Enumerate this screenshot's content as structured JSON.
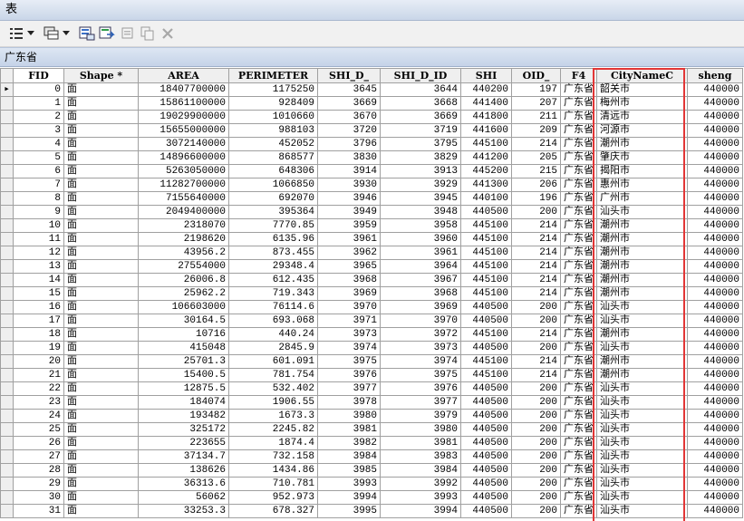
{
  "window": {
    "title": "表"
  },
  "tab": {
    "label": "广东省"
  },
  "toolbar": {
    "icons": [
      "table-options-icon",
      "dropdown-arrow-icon",
      "related-tables-icon",
      "dropdown-arrow-icon",
      "select-by-attributes-icon",
      "switch-selection-icon",
      "clear-selection-icon",
      "copy-selected-icon",
      "delete-selected-icon"
    ]
  },
  "grid": {
    "columns": [
      "FID",
      "Shape *",
      "AREA",
      "PERIMETER",
      "SHI_D_",
      "SHI_D_ID",
      "SHI",
      "OID_",
      "F4",
      "CityNameC",
      "sheng"
    ],
    "current_row_marker": "▸",
    "rows": [
      [
        "0",
        "面",
        "18407700000",
        "1175250",
        "3645",
        "3644",
        "440200",
        "197",
        "广东省",
        "韶关市",
        "440000"
      ],
      [
        "1",
        "面",
        "15861100000",
        "928409",
        "3669",
        "3668",
        "441400",
        "207",
        "广东省",
        "梅州市",
        "440000"
      ],
      [
        "2",
        "面",
        "19029900000",
        "1010660",
        "3670",
        "3669",
        "441800",
        "211",
        "广东省",
        "清远市",
        "440000"
      ],
      [
        "3",
        "面",
        "15655000000",
        "988103",
        "3720",
        "3719",
        "441600",
        "209",
        "广东省",
        "河源市",
        "440000"
      ],
      [
        "4",
        "面",
        "3072140000",
        "452052",
        "3796",
        "3795",
        "445100",
        "214",
        "广东省",
        "潮州市",
        "440000"
      ],
      [
        "5",
        "面",
        "14896600000",
        "868577",
        "3830",
        "3829",
        "441200",
        "205",
        "广东省",
        "肇庆市",
        "440000"
      ],
      [
        "6",
        "面",
        "5263050000",
        "648306",
        "3914",
        "3913",
        "445200",
        "215",
        "广东省",
        "揭阳市",
        "440000"
      ],
      [
        "7",
        "面",
        "11282700000",
        "1066850",
        "3930",
        "3929",
        "441300",
        "206",
        "广东省",
        "惠州市",
        "440000"
      ],
      [
        "8",
        "面",
        "7155640000",
        "692070",
        "3946",
        "3945",
        "440100",
        "196",
        "广东省",
        "广州市",
        "440000"
      ],
      [
        "9",
        "面",
        "2049400000",
        "395364",
        "3949",
        "3948",
        "440500",
        "200",
        "广东省",
        "汕头市",
        "440000"
      ],
      [
        "10",
        "面",
        "2318070",
        "7770.85",
        "3959",
        "3958",
        "445100",
        "214",
        "广东省",
        "潮州市",
        "440000"
      ],
      [
        "11",
        "面",
        "2198620",
        "6135.96",
        "3961",
        "3960",
        "445100",
        "214",
        "广东省",
        "潮州市",
        "440000"
      ],
      [
        "12",
        "面",
        "43956.2",
        "873.455",
        "3962",
        "3961",
        "445100",
        "214",
        "广东省",
        "潮州市",
        "440000"
      ],
      [
        "13",
        "面",
        "27554000",
        "29348.4",
        "3965",
        "3964",
        "445100",
        "214",
        "广东省",
        "潮州市",
        "440000"
      ],
      [
        "14",
        "面",
        "26006.8",
        "612.435",
        "3968",
        "3967",
        "445100",
        "214",
        "广东省",
        "潮州市",
        "440000"
      ],
      [
        "15",
        "面",
        "25962.2",
        "719.343",
        "3969",
        "3968",
        "445100",
        "214",
        "广东省",
        "潮州市",
        "440000"
      ],
      [
        "16",
        "面",
        "106603000",
        "76114.6",
        "3970",
        "3969",
        "440500",
        "200",
        "广东省",
        "汕头市",
        "440000"
      ],
      [
        "17",
        "面",
        "30164.5",
        "693.068",
        "3971",
        "3970",
        "440500",
        "200",
        "广东省",
        "汕头市",
        "440000"
      ],
      [
        "18",
        "面",
        "10716",
        "440.24",
        "3973",
        "3972",
        "445100",
        "214",
        "广东省",
        "潮州市",
        "440000"
      ],
      [
        "19",
        "面",
        "415048",
        "2845.9",
        "3974",
        "3973",
        "440500",
        "200",
        "广东省",
        "汕头市",
        "440000"
      ],
      [
        "20",
        "面",
        "25701.3",
        "601.091",
        "3975",
        "3974",
        "445100",
        "214",
        "广东省",
        "潮州市",
        "440000"
      ],
      [
        "21",
        "面",
        "15400.5",
        "781.754",
        "3976",
        "3975",
        "445100",
        "214",
        "广东省",
        "潮州市",
        "440000"
      ],
      [
        "22",
        "面",
        "12875.5",
        "532.402",
        "3977",
        "3976",
        "440500",
        "200",
        "广东省",
        "汕头市",
        "440000"
      ],
      [
        "23",
        "面",
        "184074",
        "1906.55",
        "3978",
        "3977",
        "440500",
        "200",
        "广东省",
        "汕头市",
        "440000"
      ],
      [
        "24",
        "面",
        "193482",
        "1673.3",
        "3980",
        "3979",
        "440500",
        "200",
        "广东省",
        "汕头市",
        "440000"
      ],
      [
        "25",
        "面",
        "325172",
        "2245.82",
        "3981",
        "3980",
        "440500",
        "200",
        "广东省",
        "汕头市",
        "440000"
      ],
      [
        "26",
        "面",
        "223655",
        "1874.4",
        "3982",
        "3981",
        "440500",
        "200",
        "广东省",
        "汕头市",
        "440000"
      ],
      [
        "27",
        "面",
        "37134.7",
        "732.158",
        "3984",
        "3983",
        "440500",
        "200",
        "广东省",
        "汕头市",
        "440000"
      ],
      [
        "28",
        "面",
        "138626",
        "1434.86",
        "3985",
        "3984",
        "440500",
        "200",
        "广东省",
        "汕头市",
        "440000"
      ],
      [
        "29",
        "面",
        "36313.6",
        "710.781",
        "3993",
        "3992",
        "440500",
        "200",
        "广东省",
        "汕头市",
        "440000"
      ],
      [
        "30",
        "面",
        "56062",
        "952.973",
        "3994",
        "3993",
        "440500",
        "200",
        "广东省",
        "汕头市",
        "440000"
      ],
      [
        "31",
        "面",
        "33253.3",
        "678.327",
        "3995",
        "3994",
        "440500",
        "200",
        "广东省",
        "汕头市",
        "440000"
      ]
    ]
  },
  "colors": {
    "highlight_border": "#e23636",
    "header_bg": "#efefef",
    "title_bg": "#c9d6e8"
  }
}
